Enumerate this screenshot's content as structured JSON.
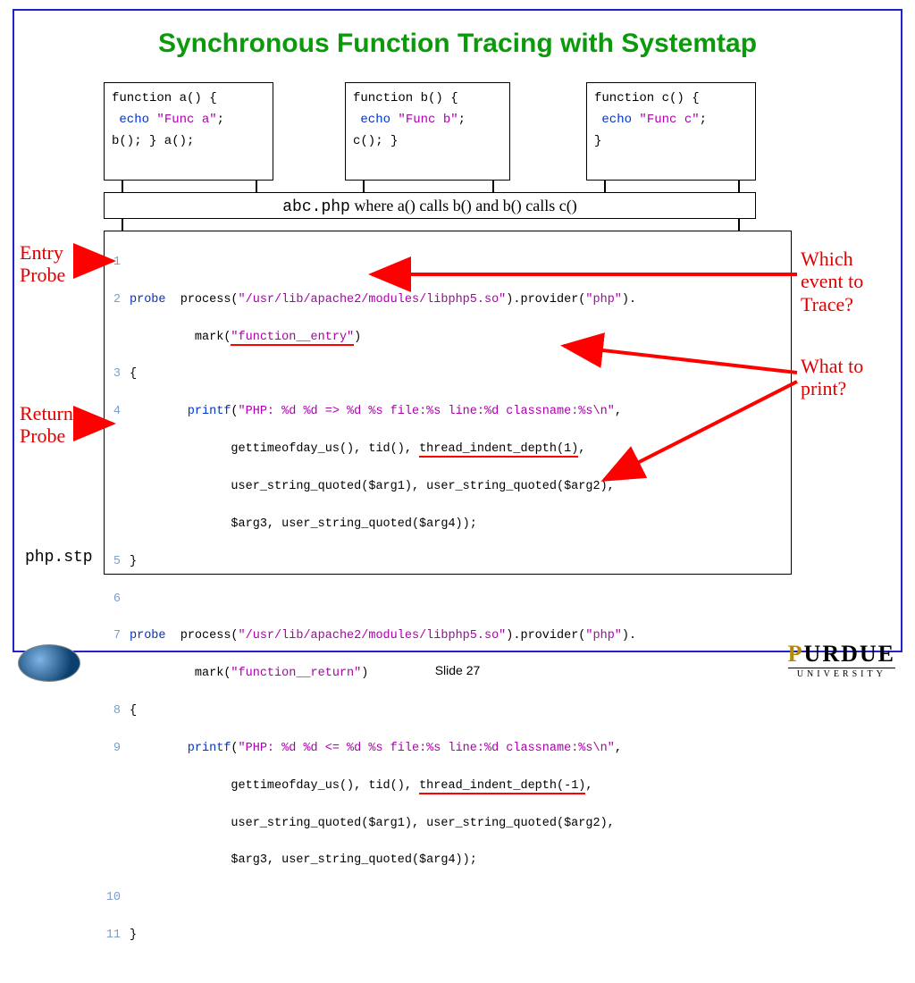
{
  "title": "Synchronous Function Tracing with Systemtap",
  "codeA": {
    "l1_a": "function",
    "l1_b": " a() {",
    "l2_a": "echo",
    "l2_b": " \"Func a\"",
    "l2_c": ";",
    "l3": "b(); } a();"
  },
  "codeB": {
    "l1_a": "function",
    "l1_b": " b() {",
    "l2_a": "echo",
    "l2_b": " \"Func b\"",
    "l2_c": ";",
    "l3": "c(); }"
  },
  "codeC": {
    "l1_a": "function",
    "l1_b": " c() {",
    "l2_a": "echo",
    "l2_b": " \"Func c\"",
    "l2_c": ";",
    "l3": "     }"
  },
  "caption_mono": "abc.php",
  "caption_rest": " where a() calls b() and b() calls c()",
  "listing": {
    "l1n": "1",
    "l2n": "2",
    "l2a": "probe",
    "l2b": "  process(",
    "l2c": "\"/usr/lib/apache2/modules/libphp5.so\"",
    "l2d": ").provider(",
    "l2e": "\"php\"",
    "l2f": ").",
    "l2g": "         mark(",
    "l2h": "\"function__entry\"",
    "l2i": ")",
    "l3n": "3",
    "l3a": "{",
    "l4n": "4",
    "l4a": "        printf",
    "l4b": "(",
    "l4c": "\"PHP: %d %d => %d %s file:%s line:%d classname:%s\\n\"",
    "l4d": ",",
    "l4e": "              gettimeofday_us(), tid(), ",
    "l4f": "thread_indent_depth(1)",
    "l4g": ",",
    "l4h": "              user_string_quoted($arg1), user_string_quoted($arg2),",
    "l4i": "              $arg3, user_string_quoted($arg4));",
    "l5n": "5",
    "l5a": "}",
    "l6n": "6",
    "l7n": "7",
    "l7a": "probe",
    "l7b": "  process(",
    "l7c": "\"/usr/lib/apache2/modules/libphp5.so\"",
    "l7d": ").provider(",
    "l7e": "\"php\"",
    "l7f": ").",
    "l7g": "         mark(",
    "l7h": "\"function__return\"",
    "l7i": ")",
    "l8n": "8",
    "l8a": "{",
    "l9n": "9",
    "l9a": "        printf",
    "l9b": "(",
    "l9c": "\"PHP: %d %d <= %d %s file:%s line:%d classname:%s\\n\"",
    "l9d": ",",
    "l9e": "              gettimeofday_us(), tid(), ",
    "l9f": "thread_indent_depth(-1)",
    "l9g": ",",
    "l9h": "              user_string_quoted($arg1), user_string_quoted($arg2),",
    "l9i": "              $arg3, user_string_quoted($arg4));",
    "l10n": "10",
    "l10a": "",
    "l11n": "11",
    "l11a": "}"
  },
  "labels": {
    "entry1": "Entry",
    "entry2": "Probe",
    "return1": "Return",
    "return2": "Probe",
    "which1": "Which",
    "which2": "event to",
    "which3": "Trace?",
    "what1": "What to",
    "what2": "print?"
  },
  "phpstp": "php.stp",
  "slideNo": "Slide 27",
  "purdue1a": "P",
  "purdue1b": "URDUE",
  "purdue2": "UNIVERSITY"
}
